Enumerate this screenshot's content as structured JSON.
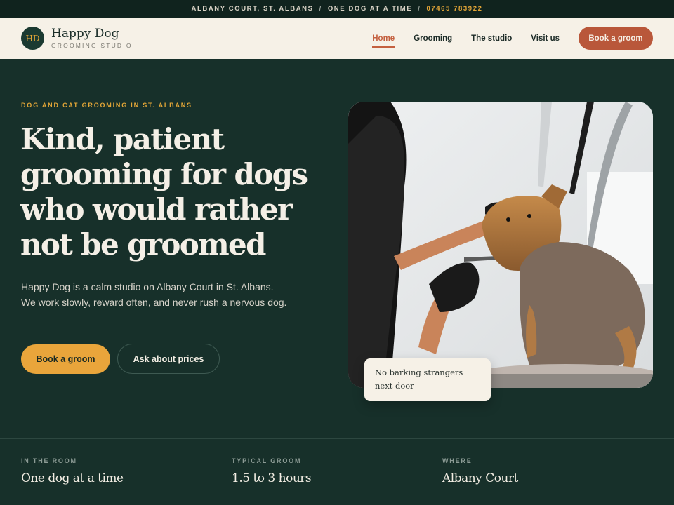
{
  "topbar": {
    "address": "ALBANY COURT, ST. ALBANS",
    "separator": "/",
    "tagline": "ONE DOG AT A TIME",
    "phone": "07465 783922"
  },
  "header": {
    "logo_initials": "HD",
    "brand_name": "Happy Dog",
    "brand_sub": "GROOMING STUDIO",
    "nav": [
      "Home",
      "Grooming",
      "The studio",
      "Visit us"
    ],
    "active_nav": "Home",
    "cta": "Book a groom"
  },
  "hero": {
    "eyebrow": "DOG AND CAT GROOMING IN ST. ALBANS",
    "title": "Kind, patient grooming for dogs who would rather not be groomed",
    "copy": "Happy Dog is a calm studio on Albany Court in St. Albans. We work slowly, reward often, and never rush a nervous dog.",
    "primary_button": "Book a groom",
    "secondary_button": "Ask about prices",
    "photo_note": "No barking strangers next door"
  },
  "stats": [
    {
      "label": "IN THE ROOM",
      "value": "One dog at a time"
    },
    {
      "label": "TYPICAL GROOM",
      "value": "1.5 to 3 hours"
    },
    {
      "label": "WHERE",
      "value": "Albany Court"
    }
  ],
  "colors": {
    "accent": "#e9a53b",
    "brand_red": "#b9573a",
    "dark_green": "#17302a",
    "cream": "#f6f1e7"
  }
}
